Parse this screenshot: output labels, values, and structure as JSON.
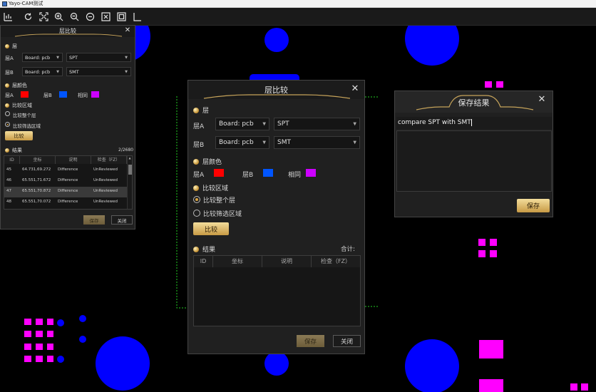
{
  "app": {
    "title": "Yayo-CAM测试"
  },
  "toolbar": {
    "icons": [
      "measure-icon",
      "rotate-icon",
      "fit-icon",
      "zoom-in-icon",
      "zoom-out-icon",
      "zoom-area-icon",
      "frame-icon",
      "board-icon",
      "corner-icon"
    ]
  },
  "colors": {
    "layer_a": "#ff0000",
    "layer_b": "#0055ff",
    "same": "#cc00ff",
    "gold": "#d9a441"
  },
  "dialog_small": {
    "title": "层比较",
    "layer_section": "层",
    "layer_a_label": "层A",
    "layer_a_board": "Board: pcb",
    "layer_a_layer": "SPT",
    "layer_b_label": "层B",
    "layer_b_board": "Board: pcb",
    "layer_b_layer": "SMT",
    "color_section": "层颜色",
    "color_a_label": "层A",
    "color_b_label": "层B",
    "color_same_label": "相同",
    "area_section": "比较区域",
    "area_whole": "比较整个层",
    "area_filter": "比较筛选区域",
    "compare_button": "比较",
    "result_section": "结果",
    "result_count": "2/2680",
    "columns": [
      "ID",
      "坐标",
      "说明",
      "检查（FZ）"
    ],
    "rows": [
      {
        "id": "45",
        "coord": "64.731,69.272",
        "desc": "Difference",
        "check": "UnReviewed"
      },
      {
        "id": "46",
        "coord": "65.551,71.672",
        "desc": "Difference",
        "check": "UnReviewed"
      },
      {
        "id": "47",
        "coord": "65.551,70.872",
        "desc": "Difference",
        "check": "UnReviewed"
      },
      {
        "id": "48",
        "coord": "65.551,70.072",
        "desc": "Difference",
        "check": "UnReviewed"
      }
    ],
    "save_button": "保存",
    "close_button": "关闭"
  },
  "dialog_main": {
    "title": "层比较",
    "layer_section": "层",
    "layer_a_label": "层A",
    "layer_a_board": "Board: pcb",
    "layer_a_layer": "SPT",
    "layer_b_label": "层B",
    "layer_b_board": "Board: pcb",
    "layer_b_layer": "SMT",
    "color_section": "层颜色",
    "color_a_label": "层A",
    "color_b_label": "层B",
    "color_same_label": "相同",
    "area_section": "比较区域",
    "area_whole": "比较整个层",
    "area_filter": "比较筛选区域",
    "compare_button": "比较",
    "result_section": "结果",
    "total_label": "合计:",
    "columns": [
      "ID",
      "坐标",
      "说明",
      "检查（FZ）"
    ],
    "save_button": "保存",
    "close_button": "关闭"
  },
  "save_dialog": {
    "title": "保存结果",
    "name_value": "compare SPT with SMT",
    "save_button": "保存"
  }
}
